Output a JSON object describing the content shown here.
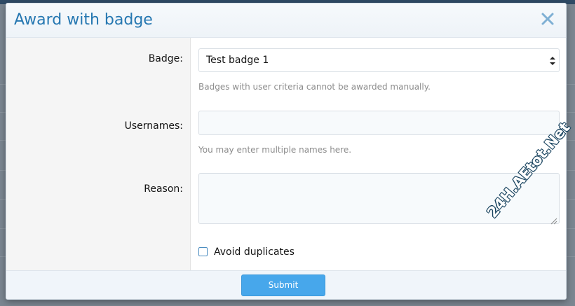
{
  "overlay": {
    "title": "Award with badge"
  },
  "form": {
    "badge": {
      "label": "Badge:",
      "selected": "Test badge 1",
      "hint": "Badges with user criteria cannot be awarded manually."
    },
    "usernames": {
      "label": "Usernames:",
      "value": "",
      "hint": "You may enter multiple names here."
    },
    "reason": {
      "label": "Reason:",
      "value": ""
    },
    "avoid_duplicates": {
      "label": "Avoid duplicates",
      "checked": false
    }
  },
  "footer": {
    "submit_label": "Submit"
  },
  "watermark": {
    "text": "24H.AEtot.Net"
  },
  "colors": {
    "title": "#2577b1",
    "submit_bg": "#47a7eb",
    "checkbox_border": "#4a8cc0"
  },
  "icons": {
    "close": "close-icon",
    "select_arrows": "chevron-up-down-icon",
    "resize": "resize-handle-icon"
  }
}
